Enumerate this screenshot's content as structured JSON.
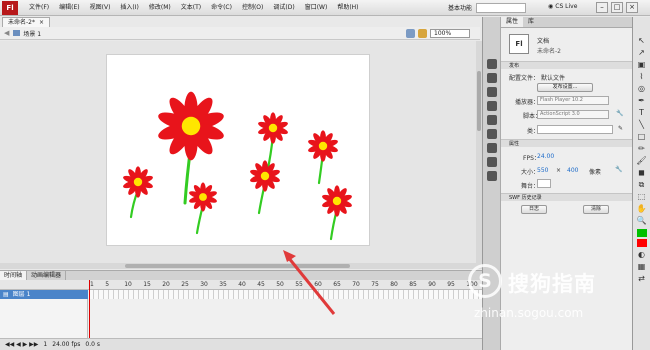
{
  "app": {
    "logo": "Fl",
    "menu": [
      "文件(F)",
      "编辑(E)",
      "视图(V)",
      "插入(I)",
      "修改(M)",
      "文本(T)",
      "命令(C)",
      "控制(O)",
      "调试(D)",
      "窗口(W)",
      "帮助(H)"
    ],
    "workspace": "基本功能",
    "cs_live": "CS Live",
    "win_controls": [
      "–",
      "□",
      "×"
    ]
  },
  "document": {
    "tab_label": "未命名-2*",
    "tab_close": "×",
    "scene": "场景 1",
    "zoom": "100%"
  },
  "timeline": {
    "tabs": [
      "时间轴",
      "动画编辑器"
    ],
    "layer_name": "图层 1",
    "frame_numbers": [
      "1",
      "5",
      "10",
      "15",
      "20",
      "25",
      "30",
      "35",
      "40",
      "45",
      "50",
      "55",
      "60",
      "65",
      "70",
      "75",
      "80",
      "85",
      "90",
      "95",
      "100"
    ],
    "footer": [
      "1",
      "24.00 fps",
      "0.0 s"
    ]
  },
  "properties": {
    "tabs": [
      "属性",
      "库"
    ],
    "badge": "Fl",
    "doc_type": "文档",
    "doc_name": "未命名-2",
    "publish_section": "发布",
    "profile_label": "配置文件：",
    "profile_value": "默认文件",
    "publish_settings_btn": "发布设置...",
    "player_label": "播放器：",
    "player_value": "Flash Player 10.2",
    "script_label": "脚本：",
    "script_value": "ActionScript 3.0",
    "class_label": "类：",
    "props_section": "属性",
    "fps_label": "FPS：",
    "fps_value": "24.00",
    "size_label": "大小：",
    "width_value": "550",
    "times": "×",
    "height_value": "400",
    "unit": "像素",
    "stage_label": "舞台：",
    "swf_section": "SWF 历史记录",
    "log_btn": "日志",
    "clear_btn": "清除"
  },
  "tools": [
    "↖",
    "↗",
    "▣",
    "⌇",
    "◎",
    "✒",
    "T",
    "╲",
    "□",
    "✏",
    "🖌",
    "◼",
    "⧉",
    "⬚",
    "✋",
    "🔍",
    "◐",
    "▦",
    "⇄"
  ],
  "watermark": {
    "logo_char": "S",
    "title": "搜狗指南",
    "url": "zhinan.sogou.com"
  },
  "colors": {
    "stroke_color": "#00c000",
    "fill_color": "#ff0000",
    "petal": "#e8141b",
    "center": "#ffe600",
    "stem": "#33cc22",
    "arrow": "#e03a3a"
  }
}
